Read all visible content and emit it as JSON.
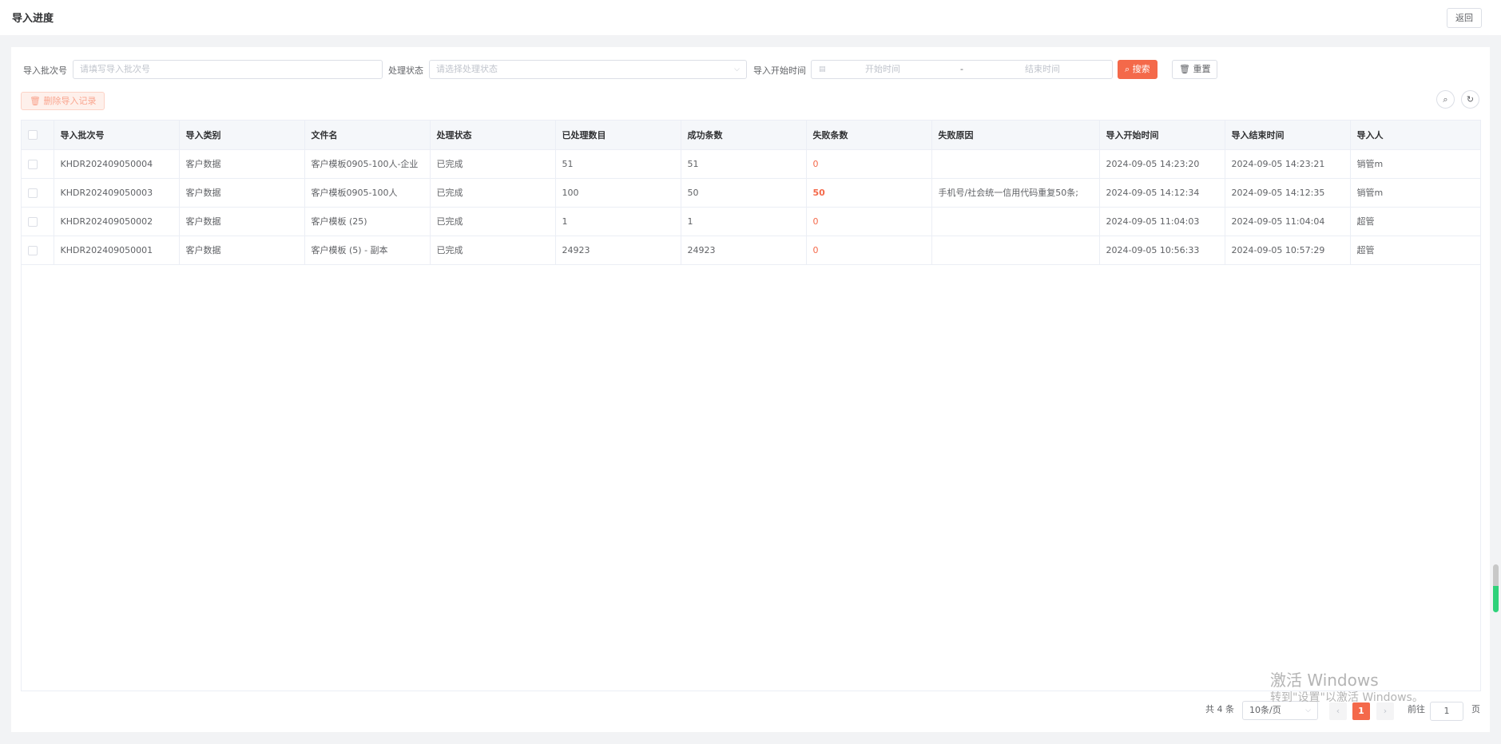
{
  "header": {
    "title": "导入进度",
    "back_label": "返回"
  },
  "filters": {
    "batch_label": "导入批次号",
    "batch_placeholder": "请填写导入批次号",
    "status_label": "处理状态",
    "status_placeholder": "请选择处理状态",
    "time_label": "导入开始时间",
    "start_placeholder": "开始时间",
    "end_placeholder": "结束时间",
    "date_separator": "-",
    "search_label": "搜索",
    "reset_label": "重置"
  },
  "toolbar": {
    "delete_label": "删除导入记录"
  },
  "table": {
    "columns": [
      "导入批次号",
      "导入类别",
      "文件名",
      "处理状态",
      "已处理数目",
      "成功条数",
      "失败条数",
      "失败原因",
      "导入开始时间",
      "导入结束时间",
      "导入人"
    ],
    "rows": [
      [
        "KHDR202409050004",
        "客户数据",
        "客户模板0905-100人-企业",
        "已完成",
        "51",
        "51",
        "0",
        "",
        "2024-09-05 14:23:20",
        "2024-09-05 14:23:21",
        "销管m"
      ],
      [
        "KHDR202409050003",
        "客户数据",
        "客户模板0905-100人",
        "已完成",
        "100",
        "50",
        "50",
        "手机号/社会统一信用代码重复50条;",
        "2024-09-05 14:12:34",
        "2024-09-05 14:12:35",
        "销管m"
      ],
      [
        "KHDR202409050002",
        "客户数据",
        "客户模板 (25)",
        "已完成",
        "1",
        "1",
        "0",
        "",
        "2024-09-05 11:04:03",
        "2024-09-05 11:04:04",
        "超管"
      ],
      [
        "KHDR202409050001",
        "客户数据",
        "客户模板 (5) - 副本",
        "已完成",
        "24923",
        "24923",
        "0",
        "",
        "2024-09-05 10:56:33",
        "2024-09-05 10:57:29",
        "超管"
      ]
    ]
  },
  "pagination": {
    "total_label": "共 4 条",
    "page_size": "10条/页",
    "current_page": "1",
    "goto_label": "前往",
    "goto_value": "1",
    "page_suffix": "页"
  },
  "watermark": {
    "line1": "激活 Windows",
    "line2": "转到\"设置\"以激活 Windows。"
  },
  "colors": {
    "accent": "#f4694a"
  }
}
